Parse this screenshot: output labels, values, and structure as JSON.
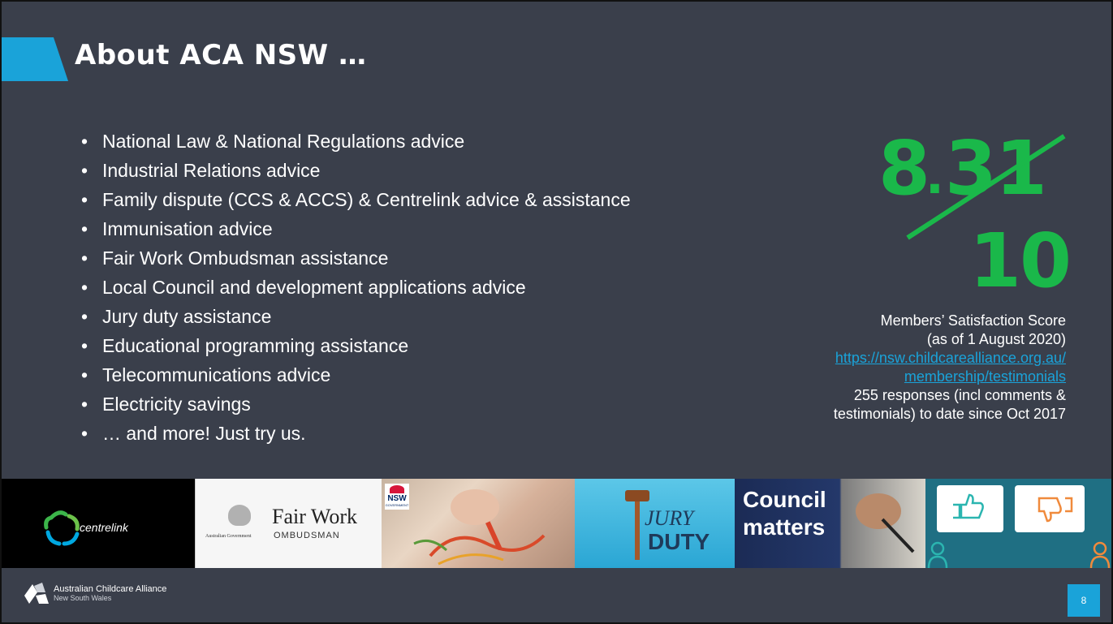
{
  "title": "About ACA NSW …",
  "bullets": [
    "National Law & National Regulations advice",
    "Industrial Relations advice",
    "Family dispute (CCS & ACCS) & Centrelink advice & assistance",
    "Immunisation advice",
    "Fair Work Ombudsman assistance",
    "Local Council and development applications advice",
    "Jury duty assistance",
    "Educational programming assistance",
    "Telecommunications advice",
    "Electricity savings",
    "… and more! Just try us."
  ],
  "score": {
    "numerator": "8",
    "decimal": ".",
    "decimals": "31",
    "denominator": "10",
    "color": "#1ab84a"
  },
  "caption": {
    "line1": "Members’ Satisfaction Score",
    "line2": "(as of 1 August 2020)",
    "link_line1": "https://nsw.childcarealliance.org.au/",
    "link_line2": "membership/testimonials",
    "line3": "255 responses (incl comments &",
    "line4": "testimonials) to date since Oct 2017"
  },
  "logos": {
    "centrelink": "centrelink",
    "fairwork_main": "Fair Work",
    "fairwork_sub": "OMBUDSMAN",
    "fairwork_gov": "Australian Government",
    "nsw": "NSW",
    "nsw_sub": "GOVERNMENT",
    "jury1": "JURY",
    "jury2": "DUTY",
    "council1": "Council",
    "council2": "matters"
  },
  "footer": {
    "org": "Australian Childcare Alliance",
    "region": "New South Wales"
  },
  "page_number": "8",
  "colors": {
    "background": "#3a3f4b",
    "accent": "#1aa3d9",
    "score_green": "#1ab84a"
  }
}
